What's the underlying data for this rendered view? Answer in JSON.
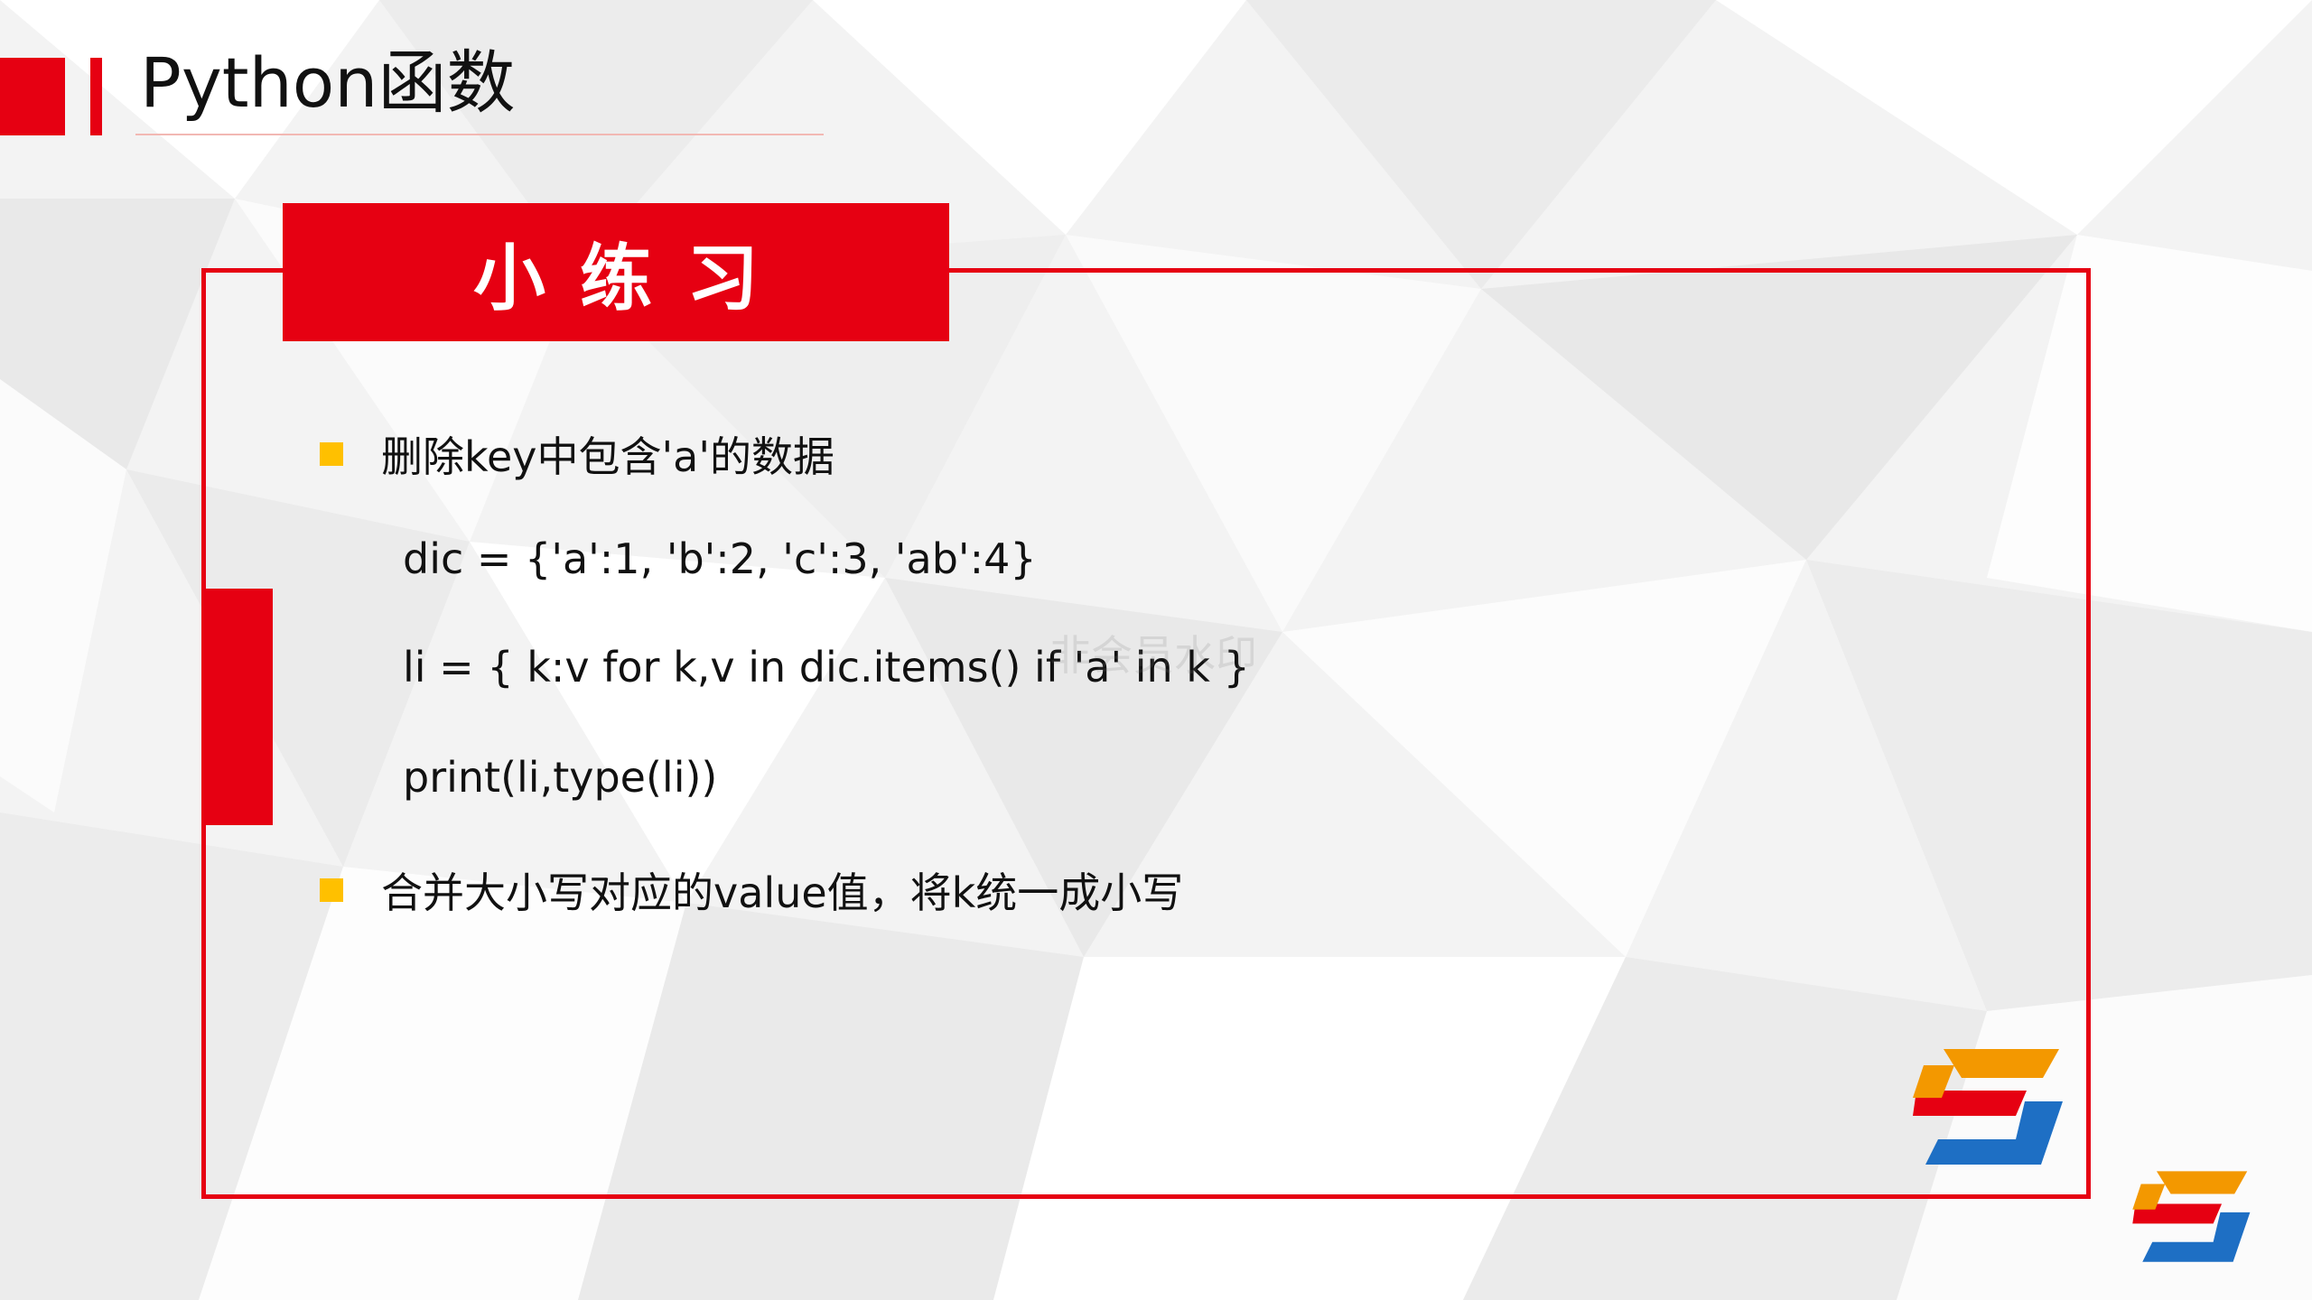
{
  "slide": {
    "title": "Python函数",
    "header": "小练习",
    "watermark": "非会员水印"
  },
  "content": {
    "bullet1": "删除key中包含'a'的数据",
    "code": [
      "dic = {'a':1, 'b':2, 'c':3, 'ab':4}",
      "li = { k:v for k,v in dic.items() if 'a' in k }",
      "print(li,type(li))"
    ],
    "bullet2": "合并大小写对应的value值，将k统一成小写"
  },
  "colors": {
    "accent": "#e60012",
    "bullet": "#ffc000",
    "logo_orange": "#f39800",
    "logo_red": "#e60012",
    "logo_blue": "#1e6fc4"
  },
  "icons": [
    "square-bullet-icon",
    "logo-icon"
  ]
}
